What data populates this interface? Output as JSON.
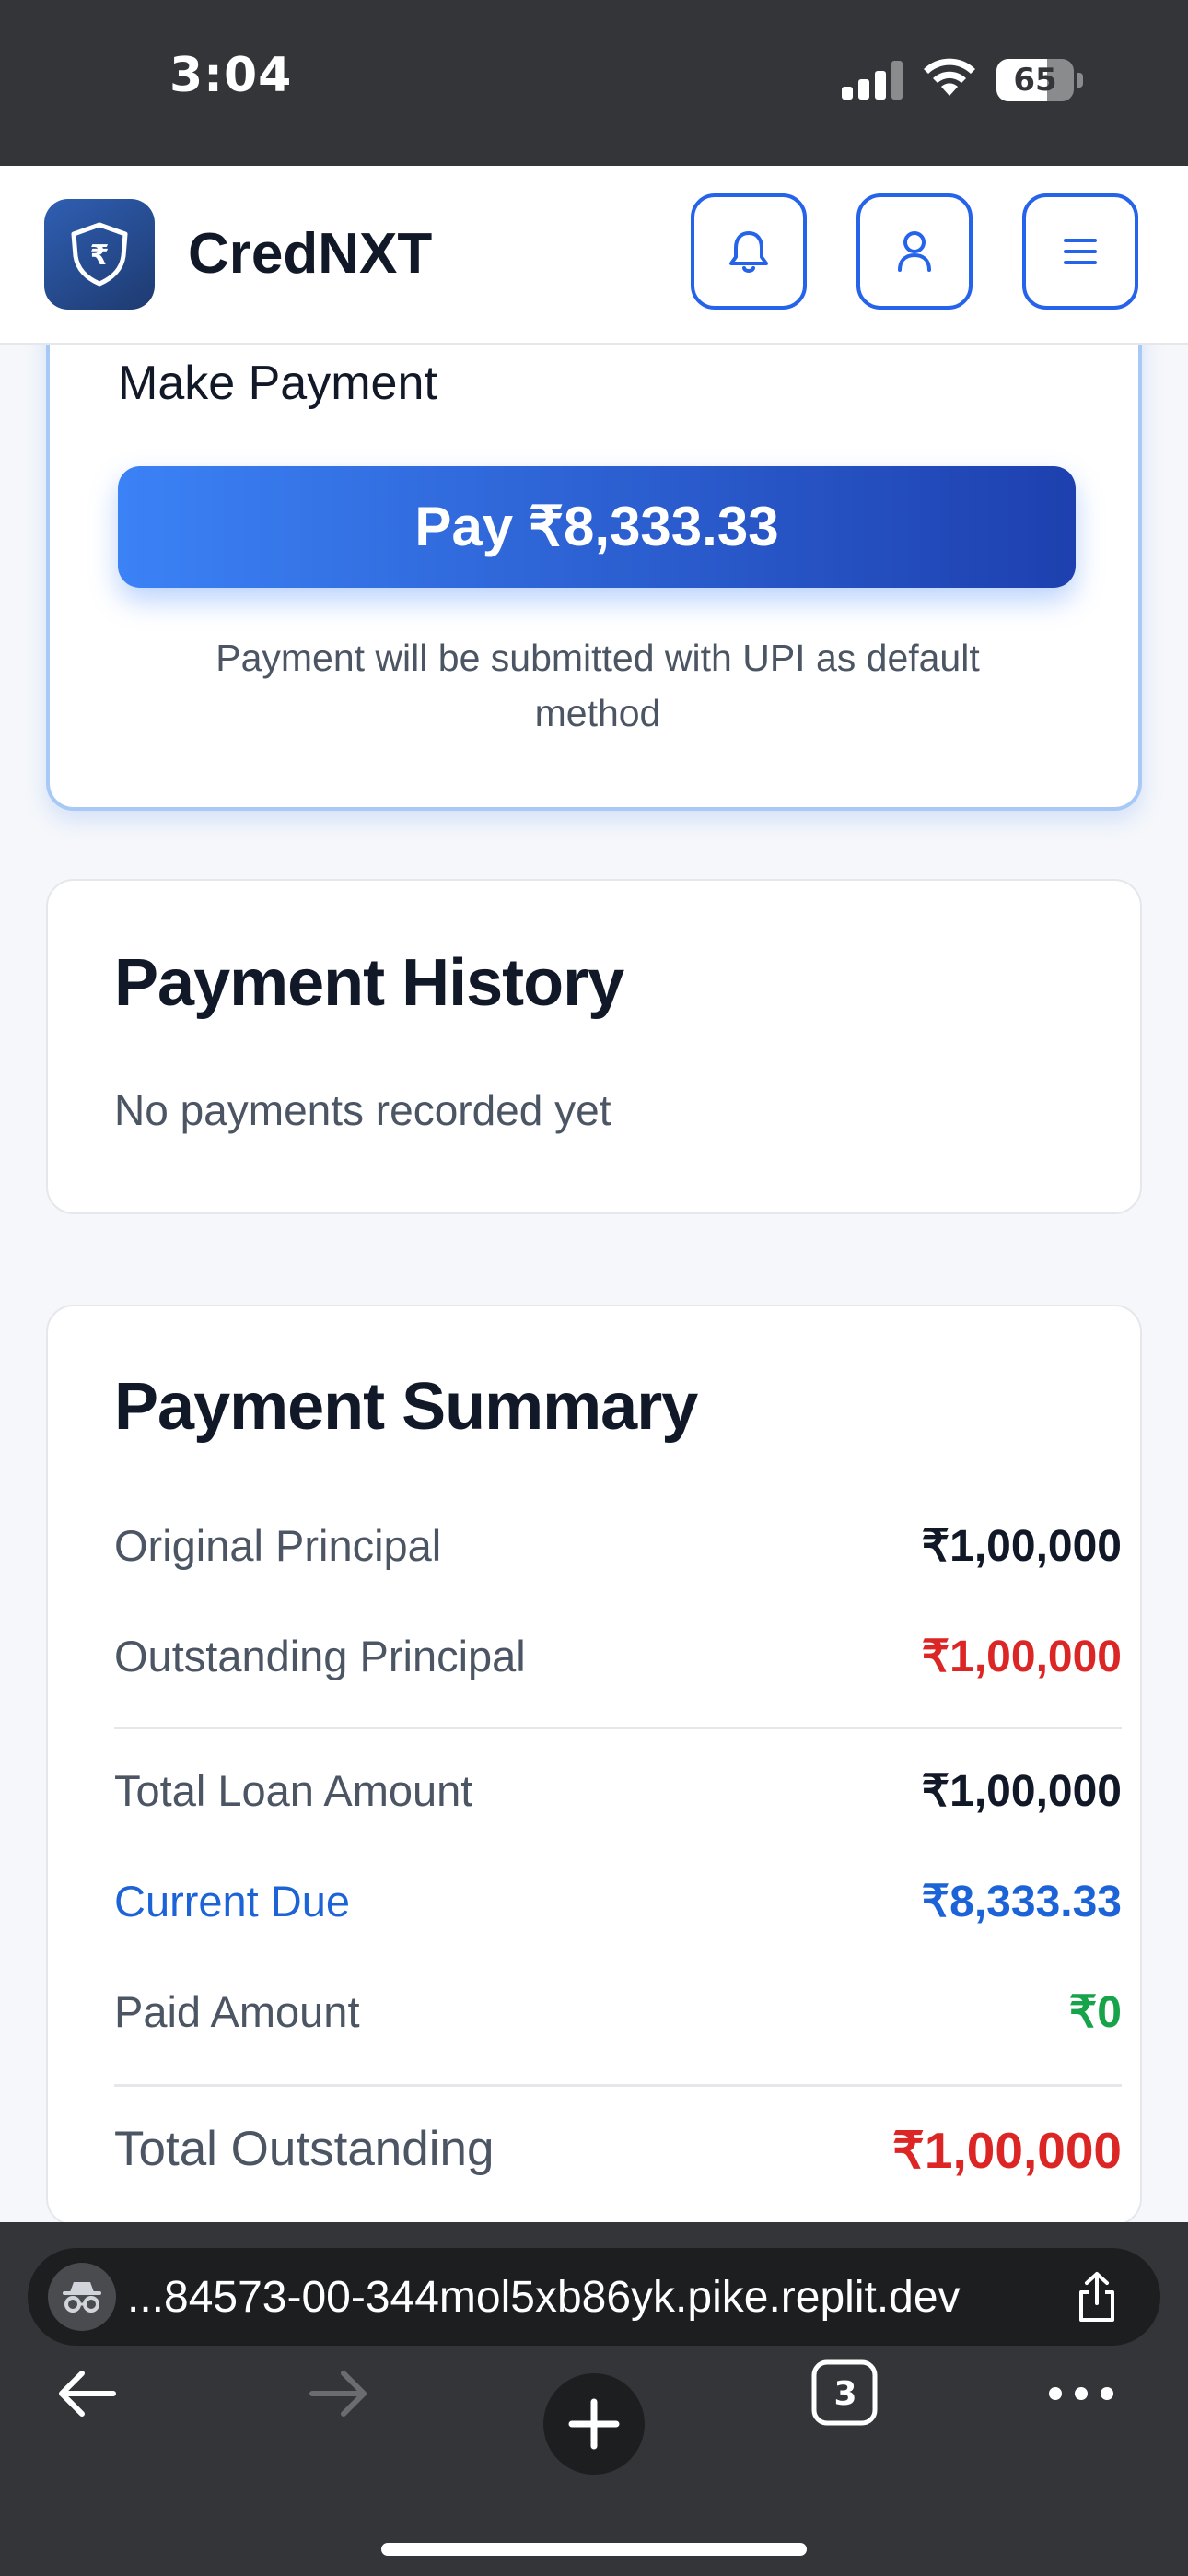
{
  "status_bar": {
    "time": "3:04",
    "battery_level": "65",
    "icons": [
      "signal-icon",
      "wifi-icon",
      "battery-icon"
    ]
  },
  "header": {
    "brand_name": "CredNXT",
    "logo_icon": "rupee-shield-icon",
    "actions": [
      "bell-icon",
      "user-icon",
      "menu-icon"
    ]
  },
  "payment_card": {
    "heading": "Make Payment",
    "pay_button_label": "Pay ₹8,333.33",
    "note": "Payment will be submitted with UPI as default method"
  },
  "history_card": {
    "title": "Payment History",
    "empty_text": "No payments recorded yet"
  },
  "summary_card": {
    "title": "Payment Summary",
    "rows": [
      {
        "label": "Original Principal",
        "value": "₹1,00,000"
      },
      {
        "label": "Outstanding Principal",
        "value": "₹1,00,000"
      },
      {
        "label": "Total Loan Amount",
        "value": "₹1,00,000"
      },
      {
        "label": "Current Due",
        "value": "₹8,333.33"
      },
      {
        "label": "Paid Amount",
        "value": "₹0"
      },
      {
        "label": "Total Outstanding",
        "value": "₹1,00,000"
      }
    ]
  },
  "browser": {
    "url": "...84573-00-344mol5xb86yk.pike.replit.dev",
    "tab_count": "3",
    "buttons": [
      "back-icon",
      "forward-icon",
      "new-tab-icon",
      "tabs-icon",
      "more-icon"
    ]
  },
  "colors": {
    "primary": "#2563eb",
    "danger": "#dc2626",
    "success": "#16a34a",
    "link": "#1d63d8",
    "status_bar_bg": "#333538"
  }
}
